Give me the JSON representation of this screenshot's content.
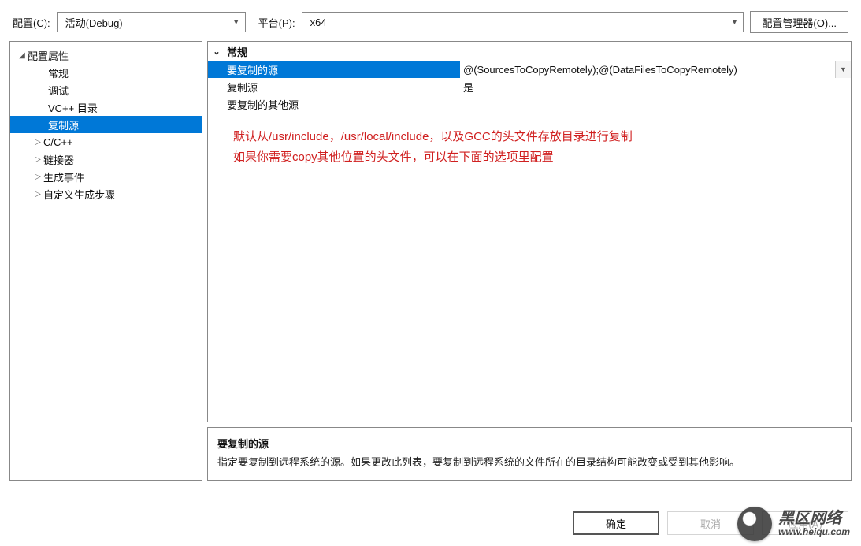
{
  "toolbar": {
    "config_label": "配置(C):",
    "config_value": "活动(Debug)",
    "platform_label": "平台(P):",
    "platform_value": "x64",
    "config_manager_btn": "配置管理器(O)..."
  },
  "tree": {
    "root": "配置属性",
    "items": [
      {
        "label": "常规",
        "expandable": false
      },
      {
        "label": "调试",
        "expandable": false
      },
      {
        "label": "VC++ 目录",
        "expandable": false
      },
      {
        "label": "复制源",
        "expandable": false,
        "selected": true
      },
      {
        "label": "C/C++",
        "expandable": true
      },
      {
        "label": "链接器",
        "expandable": true
      },
      {
        "label": "生成事件",
        "expandable": true
      },
      {
        "label": "自定义生成步骤",
        "expandable": true
      }
    ]
  },
  "grid": {
    "group": "常规",
    "rows": [
      {
        "name": "要复制的源",
        "value": "@(SourcesToCopyRemotely);@(DataFilesToCopyRemotely)",
        "selected": true,
        "dropdown": true
      },
      {
        "name": "复制源",
        "value": "是"
      },
      {
        "name": "要复制的其他源",
        "value": ""
      }
    ],
    "annotation_line1": "默认从/usr/include，/usr/local/include，以及GCC的头文件存放目录进行复制",
    "annotation_line2": "如果你需要copy其他位置的头文件，可以在下面的选项里配置"
  },
  "description": {
    "title": "要复制的源",
    "body": "指定要复制到远程系统的源。如果更改此列表，要复制到远程系统的文件所在的目录结构可能改变或受到其他影响。"
  },
  "buttons": {
    "ok": "确定",
    "cancel": "取消",
    "apply": "应用(A)"
  },
  "watermark": {
    "line1": "黑区网络",
    "line2": "www.heiqu.com"
  }
}
